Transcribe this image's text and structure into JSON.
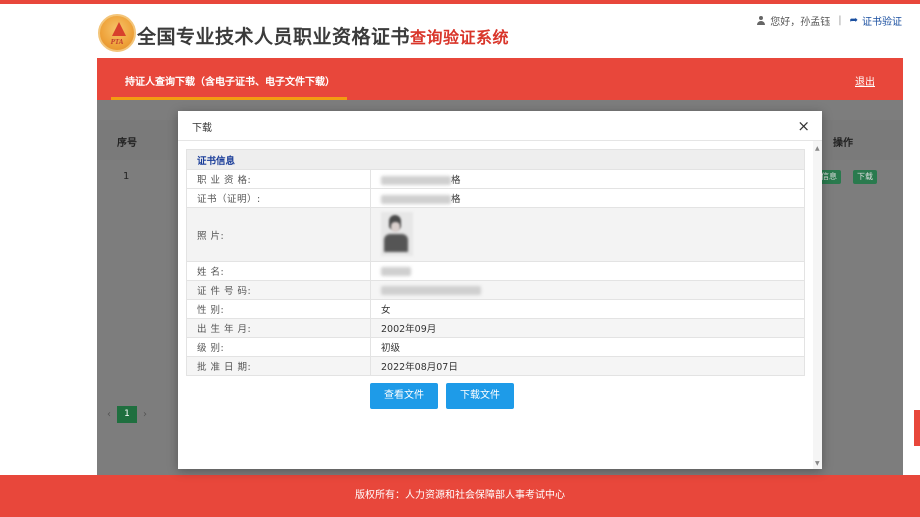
{
  "header": {
    "logo_text": "PTA",
    "title_main": "全国专业技术人员职业资格证书",
    "title_sub": "查询验证系统",
    "greeting": "您好，孙孟钰",
    "separator": "|",
    "verify_link": "证书验证"
  },
  "nav": {
    "tab_label": "持证人查询下载（含电子证书、电子文件下载）",
    "logout_label": "退出"
  },
  "list": {
    "col_seq": "序号",
    "col_op": "操作",
    "row_seq": "1",
    "info_btn": "信息",
    "download_btn": "下载",
    "page": "1"
  },
  "modal": {
    "title": "下载",
    "close": "×",
    "section_title": "证书信息",
    "rows": [
      {
        "label": "职 业 资 格:",
        "value": "格"
      },
      {
        "label": "证书（证明）:",
        "value": "格"
      },
      {
        "label": "照          片:",
        "value": ""
      },
      {
        "label": "姓          名:",
        "value": ""
      },
      {
        "label": "证 件 号 码:",
        "value": ""
      },
      {
        "label": "性          别:",
        "value": "女"
      },
      {
        "label": "出 生 年 月:",
        "value": "2002年09月"
      },
      {
        "label": "级          别:",
        "value": "初级"
      },
      {
        "label": "批 准 日 期:",
        "value": "2022年08月07日"
      }
    ],
    "view_button": "查看文件",
    "download_button": "下载文件"
  },
  "footer": {
    "copyright": "版权所有：人力资源和社会保障部人事考试中心"
  },
  "colors": {
    "brand_red": "#e8473b",
    "accent_orange": "#f39c12",
    "button_blue": "#1e9be8",
    "section_blue": "#1a3d99"
  }
}
